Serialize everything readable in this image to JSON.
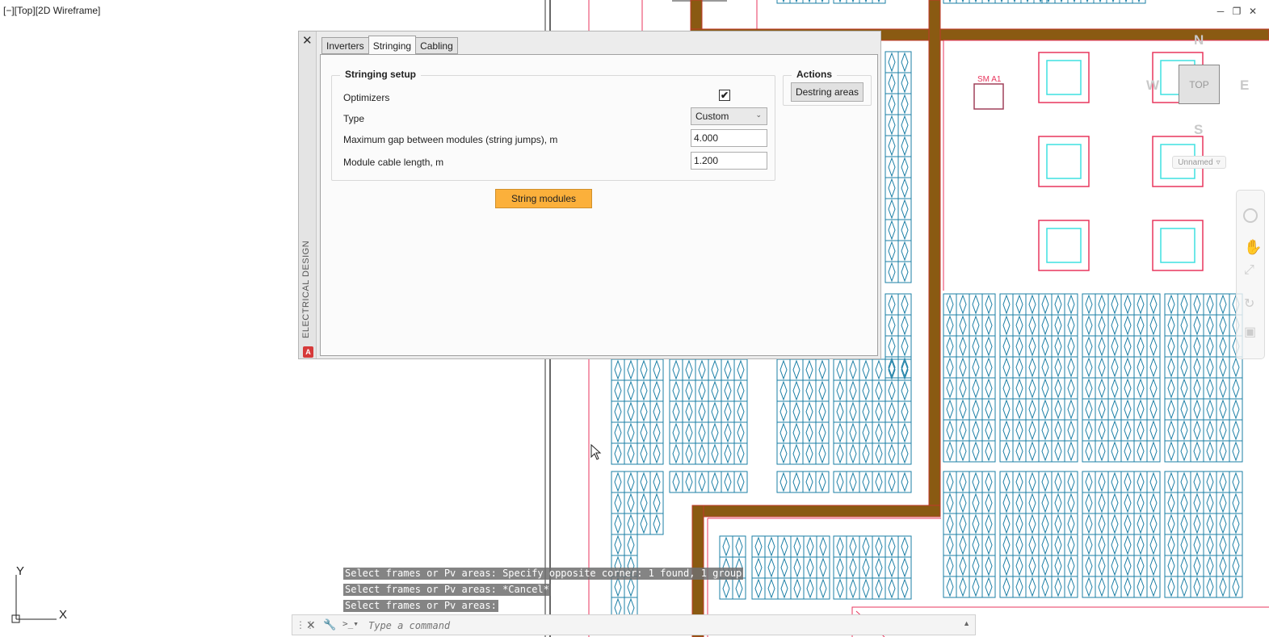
{
  "viewport": {
    "label": "[−][Top][2D Wireframe]"
  },
  "window_controls": {
    "minimize": "─",
    "restore": "❐",
    "close": "✕"
  },
  "viewcube": {
    "north": "N",
    "south": "S",
    "east": "E",
    "west": "W",
    "top": "TOP",
    "ucs": "Unnamed"
  },
  "drawing_labels": {
    "sma": "SM A1"
  },
  "ucs_icon": {
    "x": "X",
    "y": "Y"
  },
  "palette": {
    "title": "ELECTRICAL DESIGN",
    "close": "✕",
    "logo": "A",
    "tabs": [
      "Inverters",
      "Stringing",
      "Cabling"
    ],
    "active_tab": "Stringing",
    "stringing_setup": {
      "title": "Stringing setup",
      "optimizers_label": "Optimizers",
      "optimizers_checked": "✔",
      "type_label": "Type",
      "type_value": "Custom",
      "max_gap_label": "Maximum gap between modules (string jumps), m",
      "max_gap_value": "4.000",
      "cable_length_label": "Module cable length, m",
      "cable_length_value": "1.200"
    },
    "actions": {
      "title": "Actions",
      "destring": "Destring areas"
    },
    "string_button": "String modules"
  },
  "command_history": [
    "Select frames or Pv areas: Specify opposite corner: 1 found, 1 group",
    "Select frames or Pv areas: *Cancel*",
    "Select frames or Pv areas:"
  ],
  "command_line": {
    "placeholder": "Type a command"
  },
  "colors": {
    "module": "#1b7fa6",
    "boundary": "#e8365d",
    "road_fill": "#8a5a12",
    "road_edge": "#c0392b",
    "building": "#3ee0e0",
    "accent": "#fbb03b"
  }
}
